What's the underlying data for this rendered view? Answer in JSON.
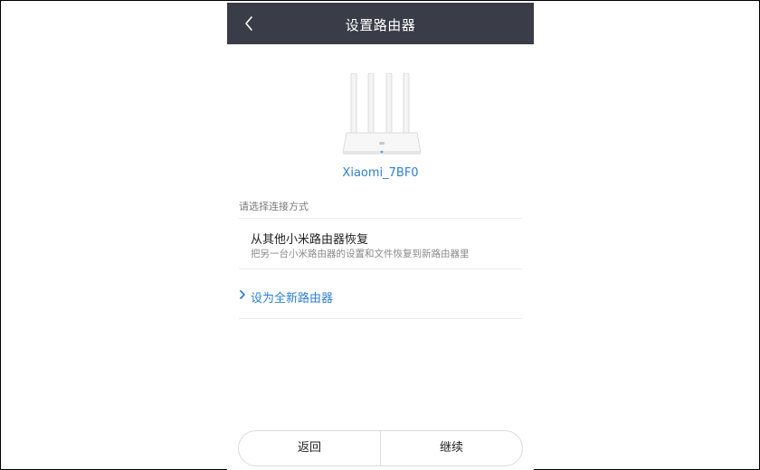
{
  "header": {
    "title": "设置路由器",
    "back_icon": "chevron-left-icon"
  },
  "device": {
    "image": "router-icon",
    "name": "Xiaomi_7BF0"
  },
  "connection": {
    "section_label": "请选择连接方式",
    "options": [
      {
        "title": "从其他小米路由器恢复",
        "description": "把另一台小米路由器的设置和文件恢复到新路由器里"
      },
      {
        "icon": "chevron-right-icon",
        "title": "设为全新路由器"
      }
    ]
  },
  "footer": {
    "back_label": "返回",
    "continue_label": "继续"
  },
  "colors": {
    "header_bg": "#3a3d48",
    "accent": "#2e7fd0"
  }
}
